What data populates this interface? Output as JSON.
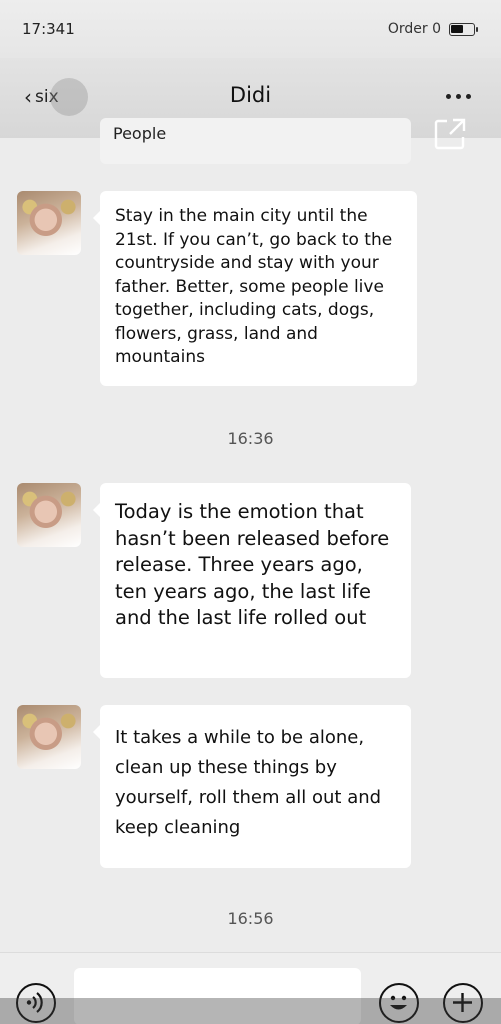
{
  "status_bar": {
    "time": "17:341",
    "carrier": "Order 0"
  },
  "header": {
    "back_label": "six",
    "title": "Didi"
  },
  "messages": [
    {
      "text": "People"
    },
    {
      "text": "Stay in the main city until the 21st. If you can’t, go back to the countryside and stay with your father. Better, some people live together, including cats, dogs, flowers, grass, land and mountains"
    },
    {
      "timestamp": "16:36"
    },
    {
      "text": "Today is the emotion that hasn’t been released before release. Three years ago, ten years ago, the last life and the last life rolled out"
    },
    {
      "text": "It takes a while to be alone, clean up these things by yourself, roll them all out and keep cleaning"
    },
    {
      "timestamp": "16:56"
    }
  ],
  "icons": {
    "back": "chevron-left-icon",
    "more": "more-dots-icon",
    "share": "share-icon",
    "voice": "voice-icon",
    "emoji": "emoji-icon",
    "plus": "plus-icon"
  },
  "colors": {
    "background": "#ececec",
    "bubble": "#ffffff"
  }
}
